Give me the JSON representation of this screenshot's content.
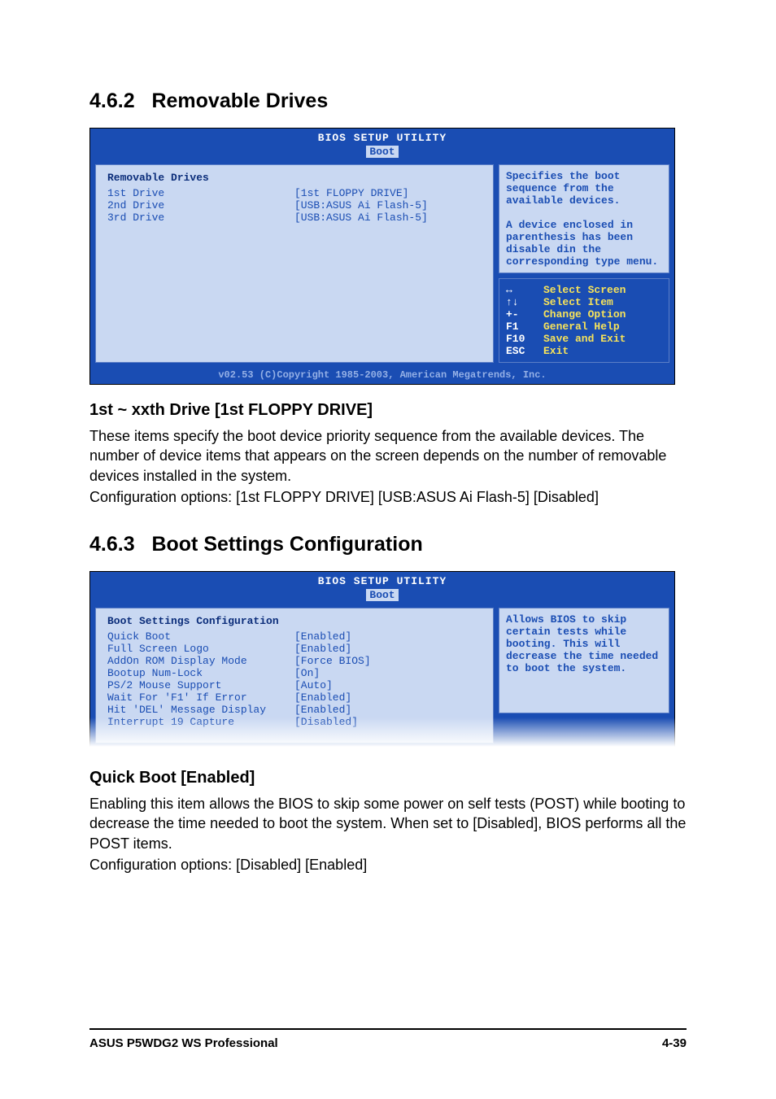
{
  "section_462": {
    "number": "4.6.2",
    "title": "Removable Drives"
  },
  "bios1": {
    "utilityTitle": "BIOS SETUP UTILITY",
    "tab": "Boot",
    "panelHeading": "Removable Drives",
    "rows": [
      {
        "label": "1st Drive",
        "value": "[1st FLOPPY DRIVE]"
      },
      {
        "label": "2nd Drive",
        "value": "[USB:ASUS Ai Flash-5]"
      },
      {
        "label": "3rd Drive",
        "value": "[USB:ASUS Ai Flash-5]"
      }
    ],
    "helpText": "Specifies the boot sequence from the available devices.\n\nA device enclosed in parenthesis has been disable din the corresponding type menu.",
    "keys": [
      {
        "sym": "↔",
        "label": "Select Screen"
      },
      {
        "sym": "↑↓",
        "label": "Select Item"
      },
      {
        "sym": "+-",
        "label": "Change Option"
      },
      {
        "sym": "F1",
        "label": "General Help"
      },
      {
        "sym": "F10",
        "label": "Save and Exit"
      },
      {
        "sym": "ESC",
        "label": "Exit"
      }
    ],
    "copyright": "v02.53 (C)Copyright 1985-2003, American Megatrends, Inc."
  },
  "sub1": {
    "heading": "1st ~ xxth Drive [1st FLOPPY DRIVE]",
    "para1": "These items specify the boot device priority sequence from the available devices. The number of device items that appears on the screen depends on the number of removable devices installed in the system.",
    "para2": "Configuration options: [1st FLOPPY DRIVE] [USB:ASUS Ai Flash-5] [Disabled]"
  },
  "section_463": {
    "number": "4.6.3",
    "title": "Boot Settings Configuration"
  },
  "bios2": {
    "utilityTitle": "BIOS SETUP UTILITY",
    "tab": "Boot",
    "panelHeading": "Boot Settings Configuration",
    "rows": [
      {
        "label": "Quick Boot",
        "value": "[Enabled]"
      },
      {
        "label": "Full Screen Logo",
        "value": "[Enabled]"
      },
      {
        "label": "AddOn ROM Display Mode",
        "value": "[Force BIOS]"
      },
      {
        "label": "Bootup Num-Lock",
        "value": "[On]"
      },
      {
        "label": "PS/2 Mouse Support",
        "value": "[Auto]"
      },
      {
        "label": "Wait For 'F1' If Error",
        "value": "[Enabled]"
      },
      {
        "label": "Hit 'DEL' Message Display",
        "value": "[Enabled]"
      },
      {
        "label": "Interrupt 19 Capture",
        "value": "[Disabled]"
      }
    ],
    "helpText": "Allows BIOS to skip certain tests while booting. This will decrease the time needed to boot the system."
  },
  "sub2": {
    "heading": "Quick Boot [Enabled]",
    "para1": "Enabling this item allows the BIOS to skip some power on self tests (POST) while booting to decrease the time needed to boot the system. When set to [Disabled], BIOS performs all the POST items.",
    "para2": "Configuration options: [Disabled] [Enabled]"
  },
  "footer": {
    "left": "ASUS P5WDG2 WS Professional",
    "right": "4-39"
  }
}
